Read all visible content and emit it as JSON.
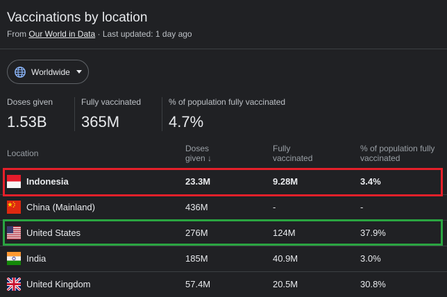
{
  "header": {
    "title": "Vaccinations by location",
    "from_text": "From ",
    "source_link": "Our World in Data",
    "updated_text": " · Last updated: 1 day ago"
  },
  "region_selector": {
    "label": "Worldwide",
    "icon": "globe-icon"
  },
  "stats": [
    {
      "label": "Doses given",
      "value": "1.53B"
    },
    {
      "label": "Fully vaccinated",
      "value": "365M"
    },
    {
      "label": "% of population fully vaccinated",
      "value": "4.7%"
    }
  ],
  "table": {
    "columns": [
      {
        "line1": "Location",
        "line2": ""
      },
      {
        "line1": "Doses",
        "line2": "given ↓"
      },
      {
        "line1": "Fully",
        "line2": "vaccinated"
      },
      {
        "line1": "% of population fully",
        "line2": "vaccinated"
      }
    ],
    "rows": [
      {
        "location": "Indonesia",
        "doses": "23.3M",
        "fully": "9.28M",
        "pct": "3.4%",
        "flag": "indonesia-flag-icon"
      },
      {
        "location": "China (Mainland)",
        "doses": "436M",
        "fully": "-",
        "pct": "-",
        "flag": "china-flag-icon"
      },
      {
        "location": "United States",
        "doses": "276M",
        "fully": "124M",
        "pct": "37.9%",
        "flag": "us-flag-icon"
      },
      {
        "location": "India",
        "doses": "185M",
        "fully": "40.9M",
        "pct": "3.0%",
        "flag": "india-flag-icon"
      },
      {
        "location": "United Kingdom",
        "doses": "57.4M",
        "fully": "20.5M",
        "pct": "30.8%",
        "flag": "uk-flag-icon"
      }
    ]
  },
  "colors": {
    "background": "#202124",
    "highlight_red": "#e5202a",
    "highlight_green": "#2aa541"
  }
}
